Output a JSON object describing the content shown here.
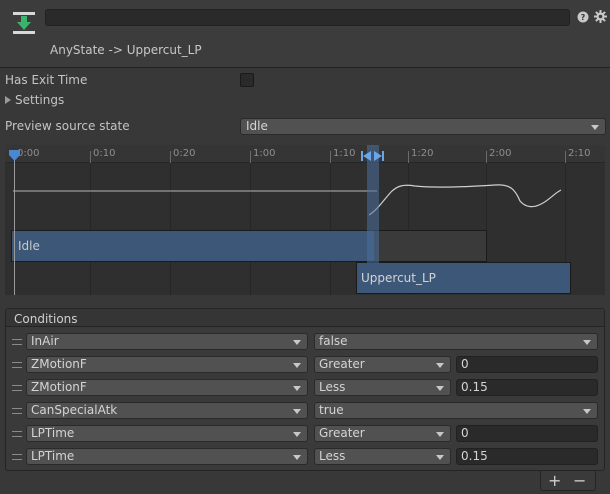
{
  "header": {
    "transition_name_value": "",
    "transition_label": "AnyState -> Uppercut_LP"
  },
  "fields": {
    "has_exit_time_label": "Has Exit Time",
    "has_exit_time_checked": false,
    "settings_label": "Settings",
    "preview_label": "Preview source state",
    "preview_value": "Idle"
  },
  "timeline": {
    "ruler_labels": [
      "0:00",
      "0:10",
      "0:20",
      "1:00",
      "1:10",
      "1:20",
      "2:00",
      "2:10"
    ],
    "source_state": "Idle",
    "destination_state": "Uppercut_LP"
  },
  "conditions": {
    "title": "Conditions",
    "rows": [
      {
        "parameter": "InAir",
        "mode": "false",
        "value": null
      },
      {
        "parameter": "ZMotionF",
        "mode": "Greater",
        "value": "0"
      },
      {
        "parameter": "ZMotionF",
        "mode": "Less",
        "value": "0.15"
      },
      {
        "parameter": "CanSpecialAtk",
        "mode": "true",
        "value": null
      },
      {
        "parameter": "LPTime",
        "mode": "Greater",
        "value": "0"
      },
      {
        "parameter": "LPTime",
        "mode": "Less",
        "value": "0.15"
      }
    ],
    "add_label": "+",
    "remove_label": "−"
  },
  "colors": {
    "background": "#383838",
    "state_bar_blue": "#3d5778",
    "playhead_blue": "#4a88d0"
  },
  "icons": [
    "transition-icon",
    "help-icon",
    "gear-icon",
    "playhead-marker-icon",
    "drag-handle-icon",
    "chevron-down-icon"
  ]
}
